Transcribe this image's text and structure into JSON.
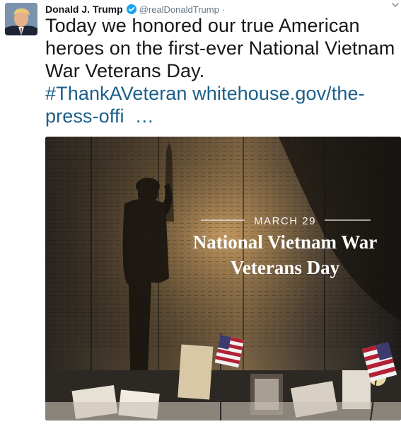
{
  "author": {
    "name": "Donald J. Trump",
    "handle": "@realDonaldTrump",
    "separator": "·",
    "verified_icon": "verified-badge-icon",
    "avatar_icon": "profile-photo"
  },
  "menu_icon": "chevron-down-icon",
  "tweet": {
    "text": "Today we honored our true American heroes on the first-ever National Vietnam War Veterans Day.",
    "hashtag": "#ThankAVeteran",
    "link": "whitehouse.gov/the-press-offi",
    "ellipsis": "…"
  },
  "media": {
    "date_label": "MARCH 29",
    "title_line1": "National Vietnam War",
    "title_line2": "Veterans Day",
    "description_icon": "veterans-day-photo"
  },
  "colors": {
    "link": "#1b5f8a",
    "verified": "#1da1f2",
    "secondary_text": "#657786"
  }
}
